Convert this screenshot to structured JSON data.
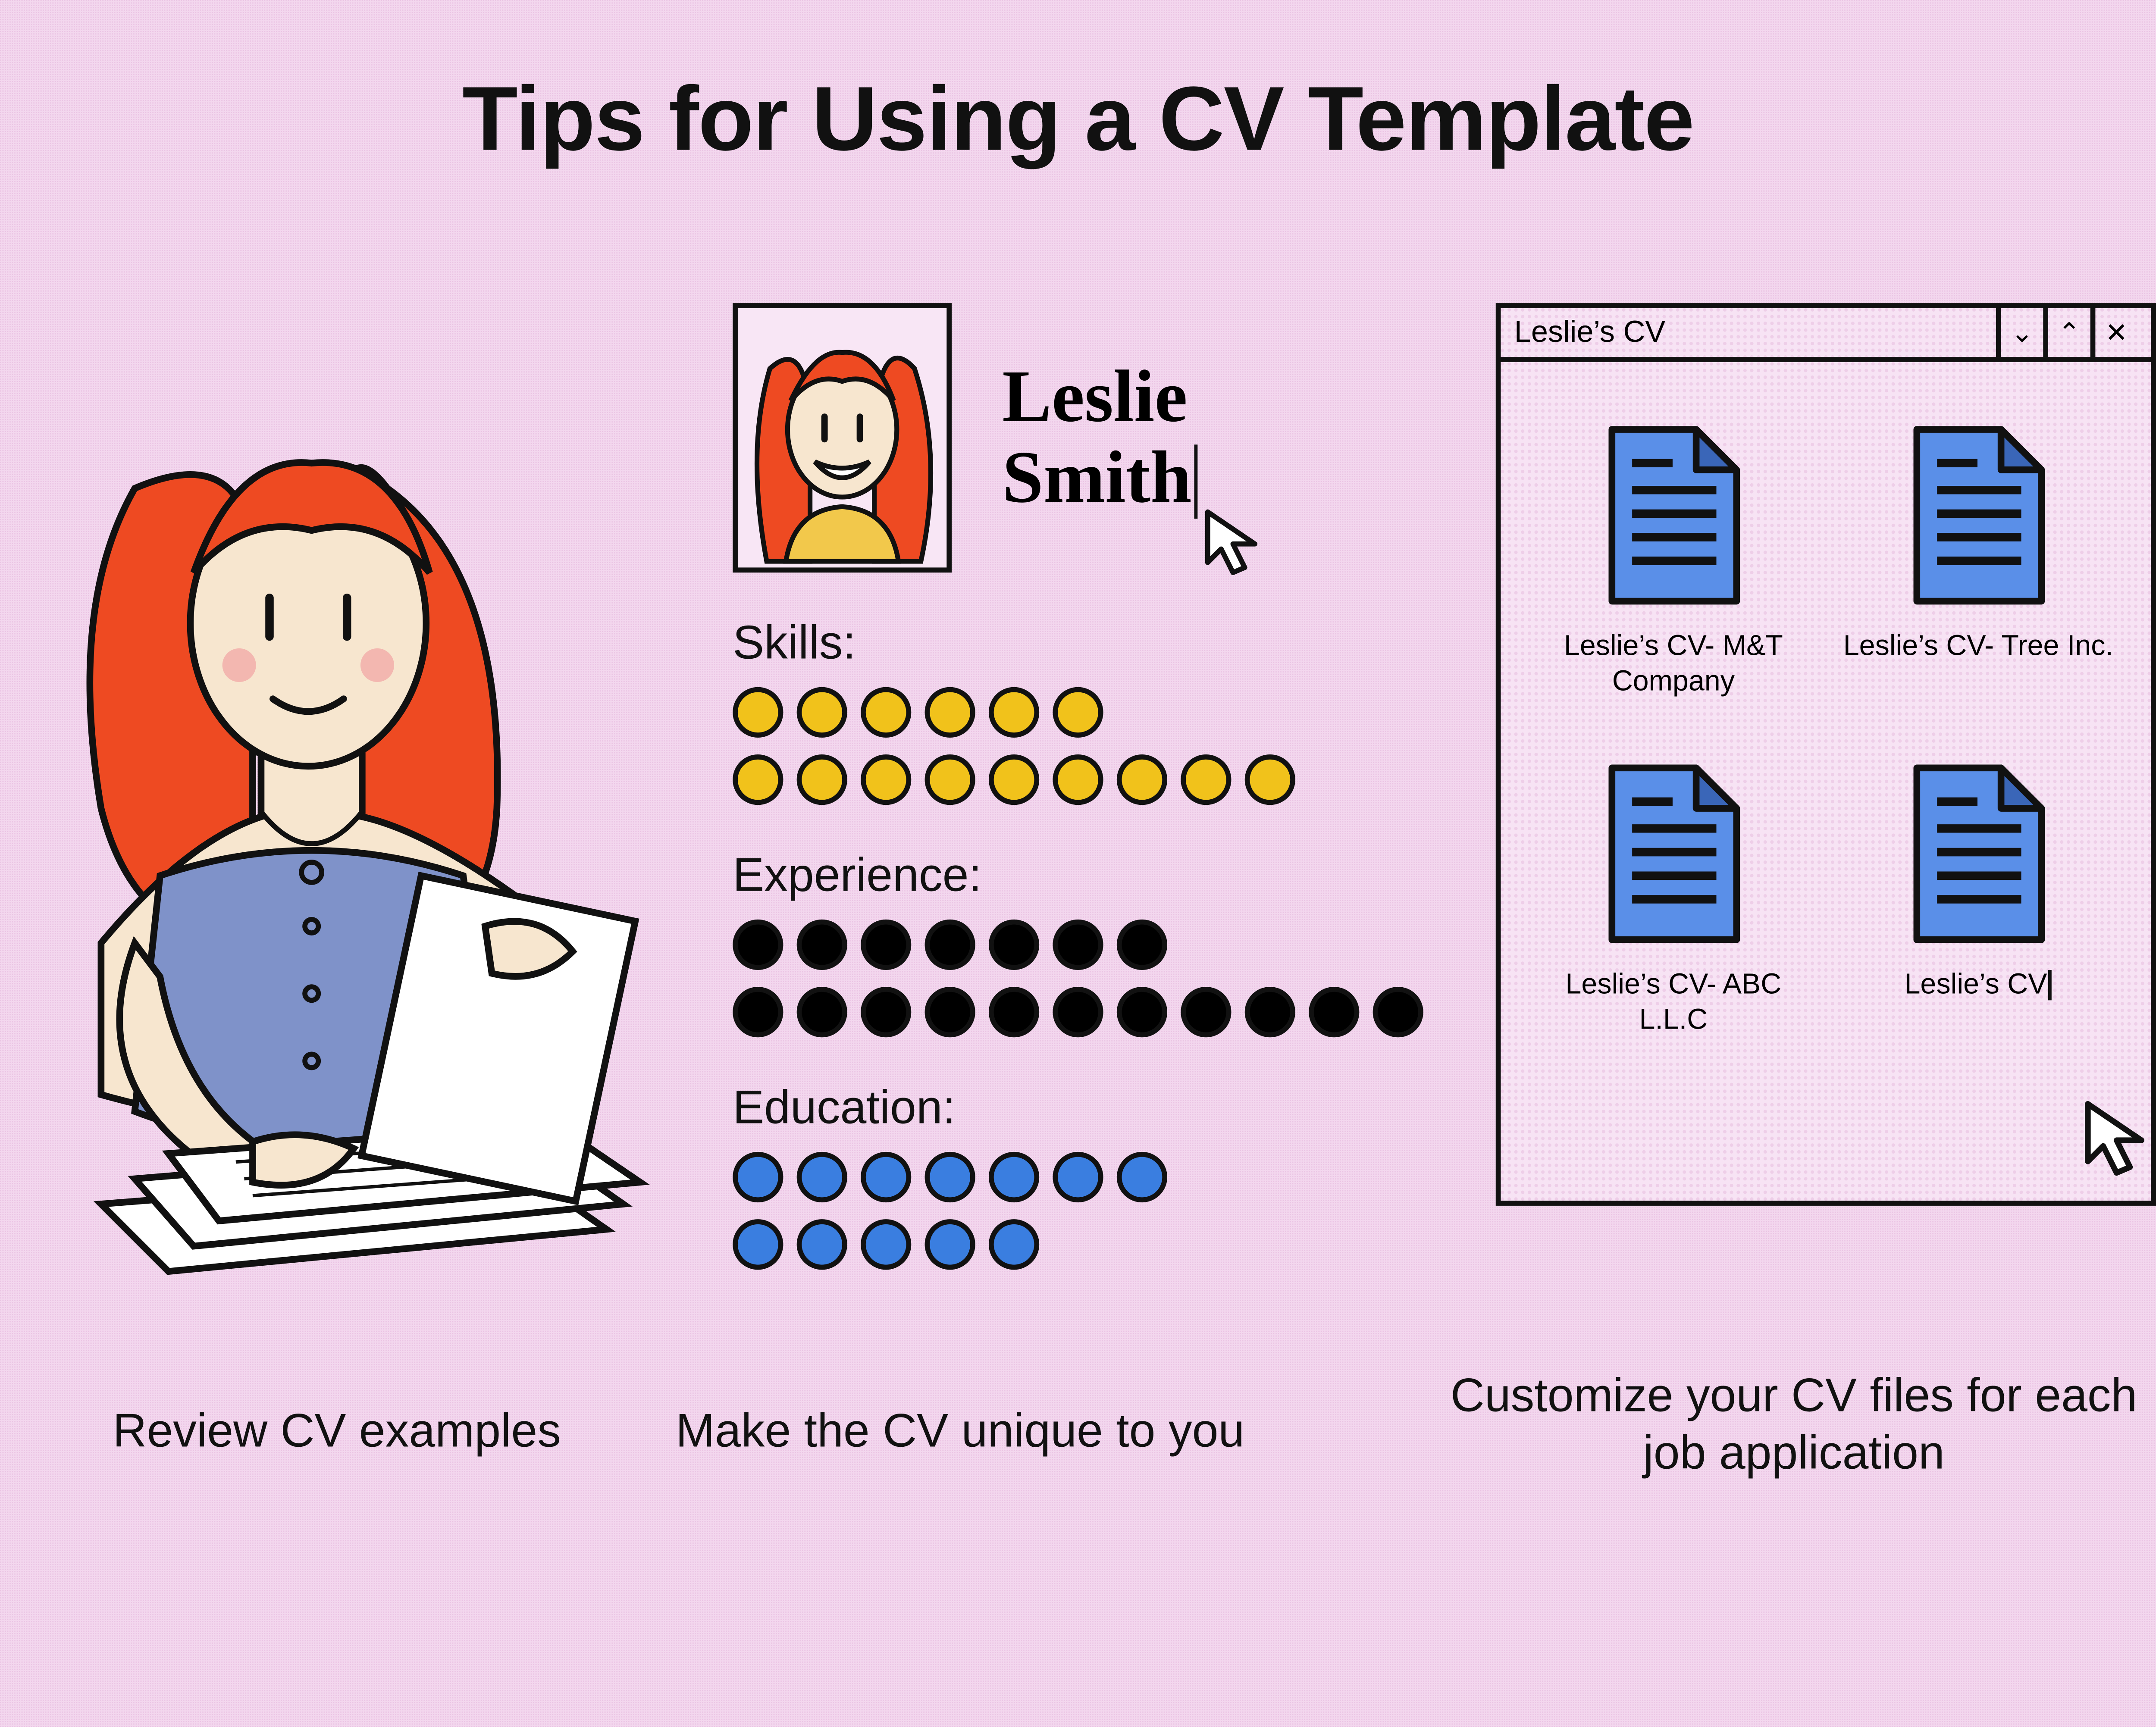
{
  "title": "Tips for Using a CV Template",
  "captions": {
    "review": "Review CV examples",
    "unique": "Make the CV unique to you",
    "customize": "Customize your CV files for each job application"
  },
  "cv": {
    "name_first": "Leslie",
    "name_last": "Smith",
    "sections": {
      "skills_label": "Skills:",
      "experience_label": "Experience:",
      "education_label": "Education:"
    },
    "dot_counts": {
      "skills_rows": [
        6,
        9
      ],
      "experience_rows": [
        7,
        11
      ],
      "education_rows": [
        7,
        5
      ]
    }
  },
  "window": {
    "title": "Leslie’s CV",
    "buttons": {
      "min": "⌄",
      "max": "⌃",
      "close": "✕"
    },
    "files": [
      {
        "label": "Leslie’s CV- M&T Company"
      },
      {
        "label": "Leslie’s CV- Tree Inc."
      },
      {
        "label": "Leslie’s CV- ABC L.L.C"
      },
      {
        "label": "Leslie’s CV",
        "renaming": true
      }
    ]
  },
  "colors": {
    "skills": "#f1c21b",
    "experience": "#000000",
    "education": "#3a7ee0",
    "file_fill": "#5a8fe8"
  }
}
